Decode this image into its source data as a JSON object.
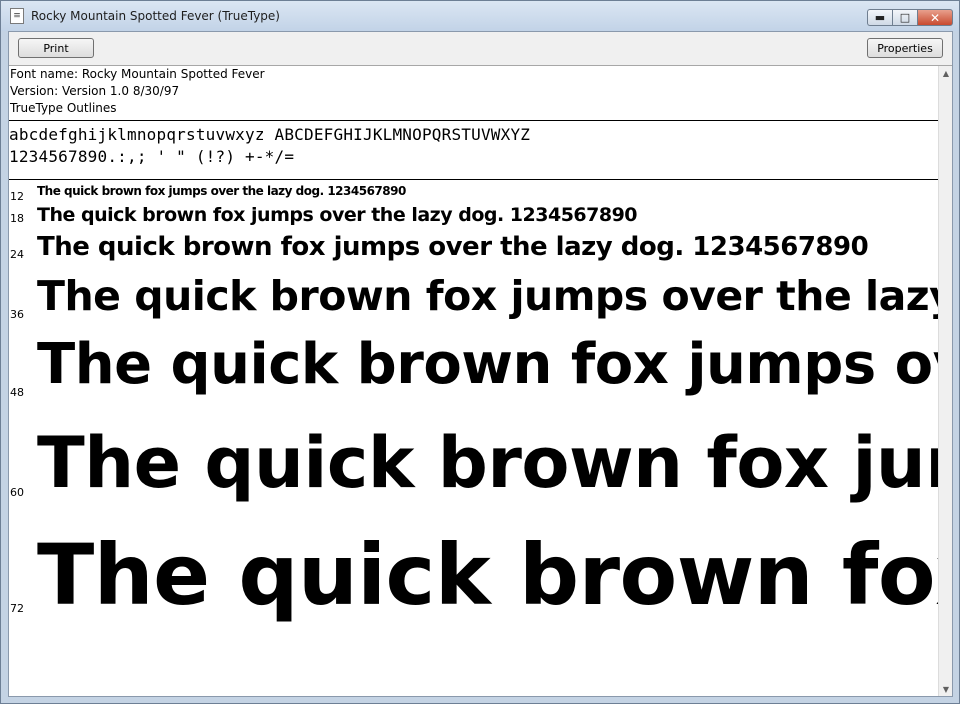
{
  "window": {
    "title": "Rocky Mountain Spotted Fever (TrueType)",
    "icon": "document-icon",
    "controls": {
      "minimize": "▬",
      "maximize": "□",
      "close": "✕"
    }
  },
  "toolbar": {
    "print_label": "Print",
    "properties_label": "Properties"
  },
  "info": {
    "font_name": "Font name: Rocky Mountain Spotted Fever",
    "version": "Version: Version 1.0 8/30/97",
    "outlines": "TrueType Outlines"
  },
  "charset": {
    "line1": "abcdefghijklmnopqrstuvwxyz ABCDEFGHIJKLMNOPQRSTUVWXYZ",
    "line2": "1234567890.:,; ' \" (!?) +-*/="
  },
  "samples": [
    {
      "size": "12",
      "text": "The quick brown fox jumps over the lazy dog. 1234567890"
    },
    {
      "size": "18",
      "text": "The quick brown fox jumps over the lazy dog. 1234567890"
    },
    {
      "size": "24",
      "text": "The quick brown fox jumps over the lazy dog. 1234567890"
    },
    {
      "size": "36",
      "text": "The quick brown fox jumps over the lazy do"
    },
    {
      "size": "48",
      "text": "The quick brown fox jumps over"
    },
    {
      "size": "60",
      "text": "The quick brown fox jumps"
    },
    {
      "size": "72",
      "text": "The quick brown fox ju"
    }
  ],
  "scrollbar": {
    "up": "▲",
    "down": "▼"
  }
}
